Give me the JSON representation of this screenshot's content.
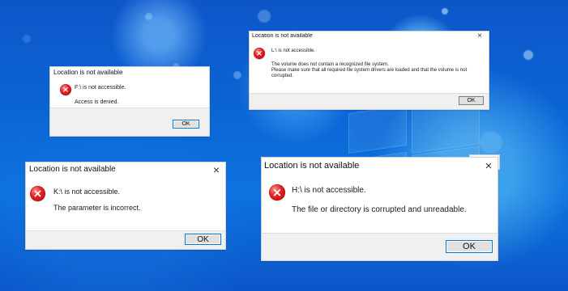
{
  "desktop": {
    "background_colors": {
      "primary": "#0b63d4",
      "deep": "#0d56c8",
      "light": "#78d2ff"
    }
  },
  "dialogs": [
    {
      "title": "Location is not available",
      "lines": [
        "F:\\ is not accessible.",
        "Access is denied."
      ],
      "ok_label": "OK",
      "icon": "error-icon"
    },
    {
      "title": "Location is not available",
      "close_label": "×",
      "lines": [
        "L:\\ is not accessible.",
        "The volume does not contain a recognized file system.",
        "Please make sure that all required file system drivers are loaded and that the volume is not",
        "corrupted."
      ],
      "ok_label": "OK",
      "icon": "error-icon"
    },
    {
      "title": "Location is not available",
      "close_label": "×",
      "lines": [
        "K:\\ is not accessible.",
        "The parameter is incorrect."
      ],
      "ok_label": "OK",
      "icon": "error-icon"
    },
    {
      "title": "Location is not available",
      "close_label": "×",
      "lines": [
        "H:\\ is not accessible.",
        "The file or directory is corrupted and unreadable."
      ],
      "ok_label": "OK",
      "icon": "error-icon"
    }
  ],
  "colors": {
    "dialog_body": "#ffffff",
    "dialog_footer": "#f0f0f0",
    "error_red": "#e02323",
    "button_border": "#7d7d7d",
    "button_focus": "#0078d7"
  }
}
